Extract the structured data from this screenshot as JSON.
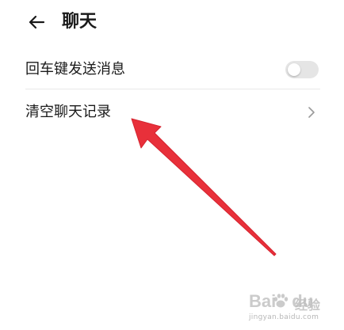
{
  "header": {
    "back_icon": "arrow-left-icon",
    "title": "聊天"
  },
  "settings": {
    "enter_to_send": {
      "label": "回车键发送消息",
      "enabled": false
    },
    "clear_history": {
      "label": "清空聊天记录",
      "icon": "chevron-right-icon"
    }
  },
  "watermark": {
    "logo": "Bai",
    "logo_tail": "du",
    "tag": "经验",
    "url": "jingyan.baidu.com"
  },
  "colors": {
    "annotation_arrow": "#e8303a",
    "toggle_off": "#e5e5e5",
    "divider": "#e8e8e8",
    "text_primary": "#1a1a1a",
    "chevron": "#9a9a9a"
  }
}
